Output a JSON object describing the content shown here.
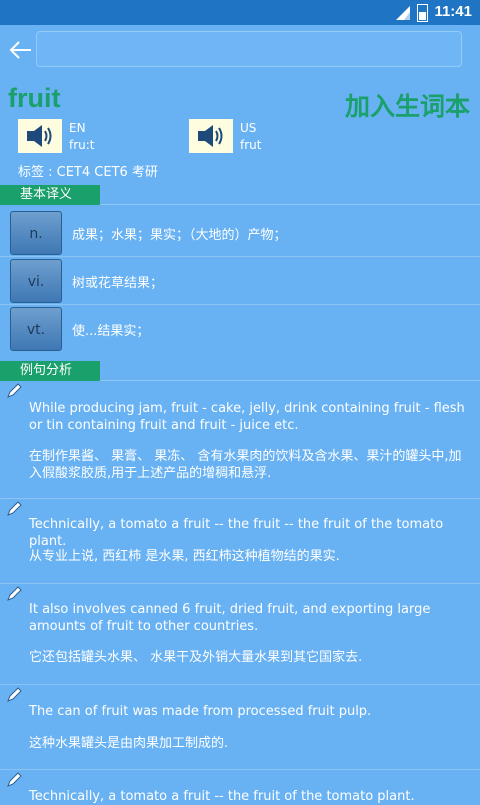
{
  "status": {
    "time": "11:41"
  },
  "search": {
    "value": ""
  },
  "word": "fruit",
  "add_vocab_label": "加入生词本",
  "pron": {
    "en": {
      "region": "EN",
      "phonetic": "fru:t"
    },
    "us": {
      "region": "US",
      "phonetic": "frut"
    }
  },
  "tags": "标签 : CET4   CET6   考研",
  "basic_section": "基本译义",
  "definitions": [
    {
      "pos": "n.",
      "text": "成果；水果；果实；（大地的）产物；"
    },
    {
      "pos": "vi.",
      "text": "树或花草结果；"
    },
    {
      "pos": "vt.",
      "text": "使...结果实；"
    }
  ],
  "examples_section": "例句分析",
  "examples": [
    {
      "en": "While producing jam, fruit - cake, jelly, drink containing fruit - flesh or tin containing fruit and fruit - juice etc.",
      "zh": "在制作果酱、 果膏、 果冻、 含有水果肉的饮料及含水果、果汁的罐头中,加入假酸浆胶质,用于上述产品的增稠和悬浮."
    },
    {
      "en": "Technically, a tomato a fruit -- the fruit -- the fruit of the tomato plant.",
      "zh": "从专业上说, 西红柿 是水果, 西红柿这种植物结的果实."
    },
    {
      "en": "It also involves canned 6 fruit, dried fruit, and exporting large amounts of fruit to other countries.",
      "zh": "它还包括罐头水果、 水果干及外销大量水果到其它国家去."
    },
    {
      "en": "The can of fruit was made from processed fruit pulp.",
      "zh": "这种水果罐头是由肉果加工制成的."
    },
    {
      "en": "Technically, a tomato a fruit -- the fruit of the tomato plant.",
      "zh": ""
    }
  ]
}
